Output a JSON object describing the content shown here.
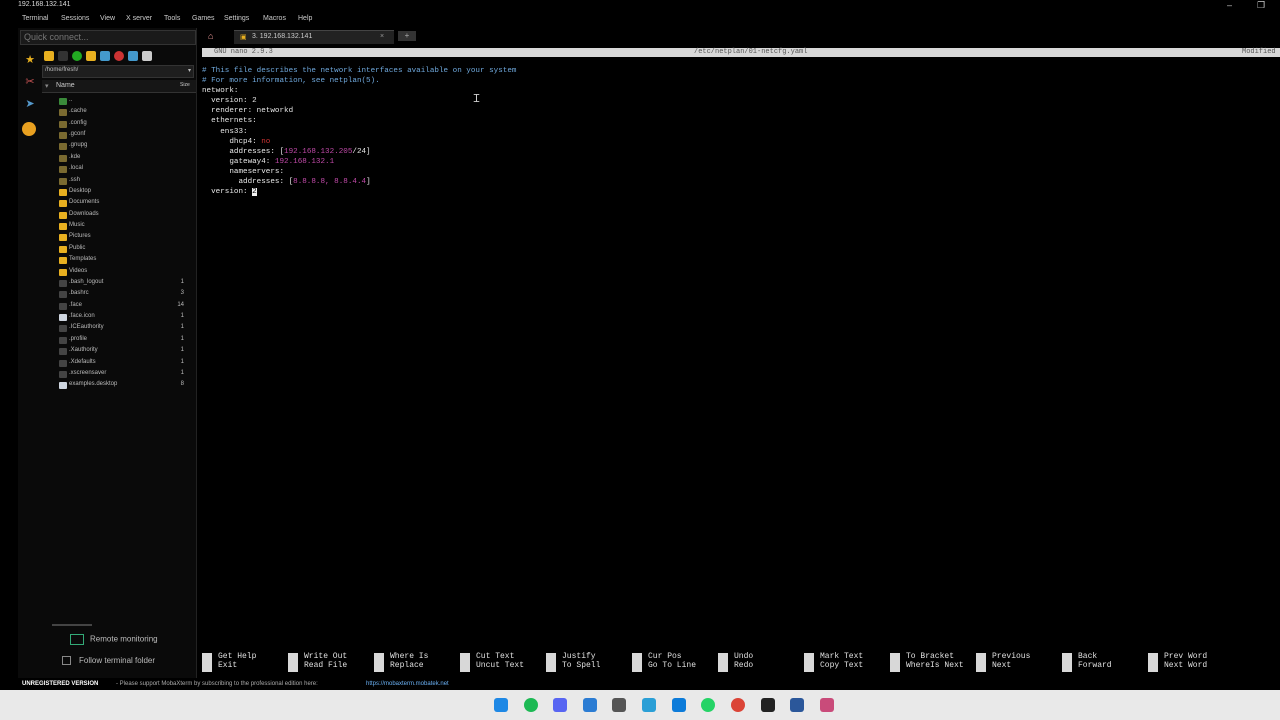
{
  "window": {
    "title": "192.168.132.141"
  },
  "menu": [
    "Terminal",
    "Sessions",
    "View",
    "X server",
    "Tools",
    "Games",
    "Settings",
    "Macros",
    "Help"
  ],
  "sidebar": {
    "quick_connect_placeholder": "Quick connect...",
    "path": "/home/fresh/",
    "col_name": "Name",
    "col_size": "Size",
    "files": [
      {
        "name": "..",
        "size": "",
        "kind": "up"
      },
      {
        "name": ".cache",
        "size": "",
        "kind": "folder-dark"
      },
      {
        "name": ".config",
        "size": "",
        "kind": "folder-dark"
      },
      {
        "name": ".gconf",
        "size": "",
        "kind": "folder-dark"
      },
      {
        "name": ".gnupg",
        "size": "",
        "kind": "folder-dark"
      },
      {
        "name": ".kde",
        "size": "",
        "kind": "folder-dark"
      },
      {
        "name": ".local",
        "size": "",
        "kind": "folder-dark"
      },
      {
        "name": ".ssh",
        "size": "",
        "kind": "folder-dark"
      },
      {
        "name": "Desktop",
        "size": "",
        "kind": "folder"
      },
      {
        "name": "Documents",
        "size": "",
        "kind": "folder"
      },
      {
        "name": "Downloads",
        "size": "",
        "kind": "folder"
      },
      {
        "name": "Music",
        "size": "",
        "kind": "folder"
      },
      {
        "name": "Pictures",
        "size": "",
        "kind": "folder"
      },
      {
        "name": "Public",
        "size": "",
        "kind": "folder"
      },
      {
        "name": "Templates",
        "size": "",
        "kind": "folder"
      },
      {
        "name": "Videos",
        "size": "",
        "kind": "folder"
      },
      {
        "name": ".bash_logout",
        "size": "1",
        "kind": "file-dark"
      },
      {
        "name": ".bashrc",
        "size": "3",
        "kind": "file-dark"
      },
      {
        "name": ".face",
        "size": "14",
        "kind": "file-dark"
      },
      {
        "name": ".face.icon",
        "size": "1",
        "kind": "file-light"
      },
      {
        "name": ".ICEauthority",
        "size": "1",
        "kind": "file-dark"
      },
      {
        "name": ".profile",
        "size": "1",
        "kind": "file-dark"
      },
      {
        "name": ".Xauthority",
        "size": "1",
        "kind": "file-dark"
      },
      {
        "name": ".Xdefaults",
        "size": "1",
        "kind": "file-dark"
      },
      {
        "name": ".xscreensaver",
        "size": "1",
        "kind": "file-dark"
      },
      {
        "name": "examples.desktop",
        "size": "8",
        "kind": "file-light"
      }
    ],
    "remote_monitoring": "Remote monitoring",
    "follow_terminal_folder": "Follow terminal folder"
  },
  "tabs": {
    "session_label": "3. 192.168.132.141",
    "close": "×",
    "new_tab": "+"
  },
  "nano": {
    "version": "GNU nano 2.9.3",
    "filename": "/etc/netplan/01-netcfg.yaml",
    "status": "Modified",
    "lines": [
      {
        "spans": [
          {
            "t": "# This file describes the network interfaces available on your system",
            "c": "cm"
          }
        ]
      },
      {
        "spans": [
          {
            "t": "# For more information, see netplan(5).",
            "c": "cm"
          }
        ]
      },
      {
        "spans": [
          {
            "t": "network:",
            "c": ""
          }
        ]
      },
      {
        "spans": [
          {
            "t": "  version: 2",
            "c": ""
          }
        ]
      },
      {
        "spans": [
          {
            "t": "  renderer: networkd",
            "c": ""
          }
        ]
      },
      {
        "spans": [
          {
            "t": "  ethernets:",
            "c": ""
          }
        ]
      },
      {
        "spans": [
          {
            "t": "    ens33:",
            "c": ""
          }
        ]
      },
      {
        "spans": [
          {
            "t": "      dhcp4: ",
            "c": ""
          },
          {
            "t": "no",
            "c": "rd"
          }
        ]
      },
      {
        "spans": [
          {
            "t": "      addresses: [",
            "c": ""
          },
          {
            "t": "192.168.132.205",
            "c": "mg"
          },
          {
            "t": "/24]",
            "c": ""
          }
        ]
      },
      {
        "spans": [
          {
            "t": "      gateway4: ",
            "c": ""
          },
          {
            "t": "192.168.132.1",
            "c": "mg"
          }
        ]
      },
      {
        "spans": [
          {
            "t": "      nameservers:",
            "c": ""
          }
        ]
      },
      {
        "spans": [
          {
            "t": "        addresses: [",
            "c": ""
          },
          {
            "t": "8.8.8.8, 8.8.4.4",
            "c": "mg"
          },
          {
            "t": "]",
            "c": ""
          }
        ]
      },
      {
        "spans": [
          {
            "t": "  version: ",
            "c": ""
          },
          {
            "t": "2",
            "c": "cur"
          }
        ]
      }
    ],
    "shortcuts": [
      {
        "key": "^G",
        "l1": "Get Help",
        "l2": "Exit"
      },
      {
        "key": "^O",
        "l1": "Write Out",
        "l2": "Read File"
      },
      {
        "key": "^W",
        "l1": "Where Is",
        "l2": "Replace"
      },
      {
        "key": "^K",
        "l1": "Cut Text",
        "l2": "Uncut Text"
      },
      {
        "key": "^J",
        "l1": "Justify",
        "l2": "To Spell"
      },
      {
        "key": "^C",
        "l1": "Cur Pos",
        "l2": "Go To Line"
      },
      {
        "key": "M-U",
        "l1": "Undo",
        "l2": "Redo"
      },
      {
        "key": "M-A",
        "l1": "Mark Text",
        "l2": "Copy Text"
      },
      {
        "key": "M-]",
        "l1": "To Bracket",
        "l2": "WhereIs Next"
      },
      {
        "key": "^B",
        "l1": "Previous",
        "l2": "Next"
      },
      {
        "key": "^F",
        "l1": "Back",
        "l2": "Forward"
      },
      {
        "key": "M-Sp",
        "l1": "Prev Word",
        "l2": "Next Word"
      }
    ]
  },
  "status_bar": {
    "unregistered": "UNREGISTERED VERSION",
    "message": "-  Please support MobaXterm by subscribing to the professional edition here:",
    "link": "https://mobaxterm.mobatek.net"
  },
  "taskbar": {
    "icons": [
      {
        "name": "windows-start-icon",
        "color": "#1e88e5"
      },
      {
        "name": "spotify-icon",
        "color": "#1db954"
      },
      {
        "name": "discord-icon",
        "color": "#5865f2"
      },
      {
        "name": "mail-icon",
        "color": "#2b7cd3"
      },
      {
        "name": "mobaxterm-icon",
        "color": "#555555"
      },
      {
        "name": "windows-app-icon",
        "color": "#2a9fd6"
      },
      {
        "name": "edge-icon",
        "color": "#0c7bd9"
      },
      {
        "name": "whatsapp-icon",
        "color": "#25d366"
      },
      {
        "name": "chrome-icon",
        "color": "#db4437"
      },
      {
        "name": "github-icon",
        "color": "#222222"
      },
      {
        "name": "word-icon",
        "color": "#2b579a"
      },
      {
        "name": "snipping-icon",
        "color": "#c94b7a"
      }
    ]
  },
  "colors": {
    "accent": "#e8a020",
    "folder": "#e8b020"
  }
}
